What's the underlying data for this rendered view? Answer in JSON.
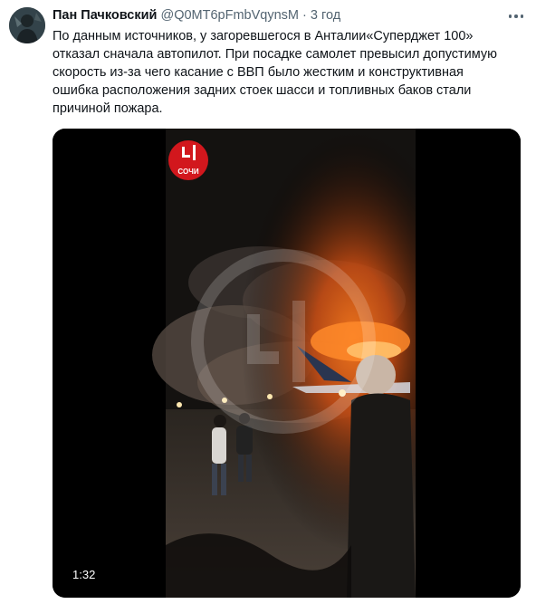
{
  "tweet": {
    "author_name": "Пан Пачковский",
    "handle": "@Q0MT6pFmbVqynsM",
    "separator": "·",
    "time": "3 год",
    "text_lines": [
      "По данным источников, у загоревшегося в Анталии«Суперджет 100»",
      "отказал сначала автопилот. При посадке самолет превысил допустимую",
      "скорость из-за чего касание с ВВП было жестким и конструктивная",
      "ошибка расположения задних стоек шасси и топливных баков стали",
      "причиной пожара."
    ]
  },
  "media": {
    "watermark_text": "СОЧИ",
    "duration": "1:32"
  },
  "icons": {
    "more": "more-horizontal-icon"
  }
}
